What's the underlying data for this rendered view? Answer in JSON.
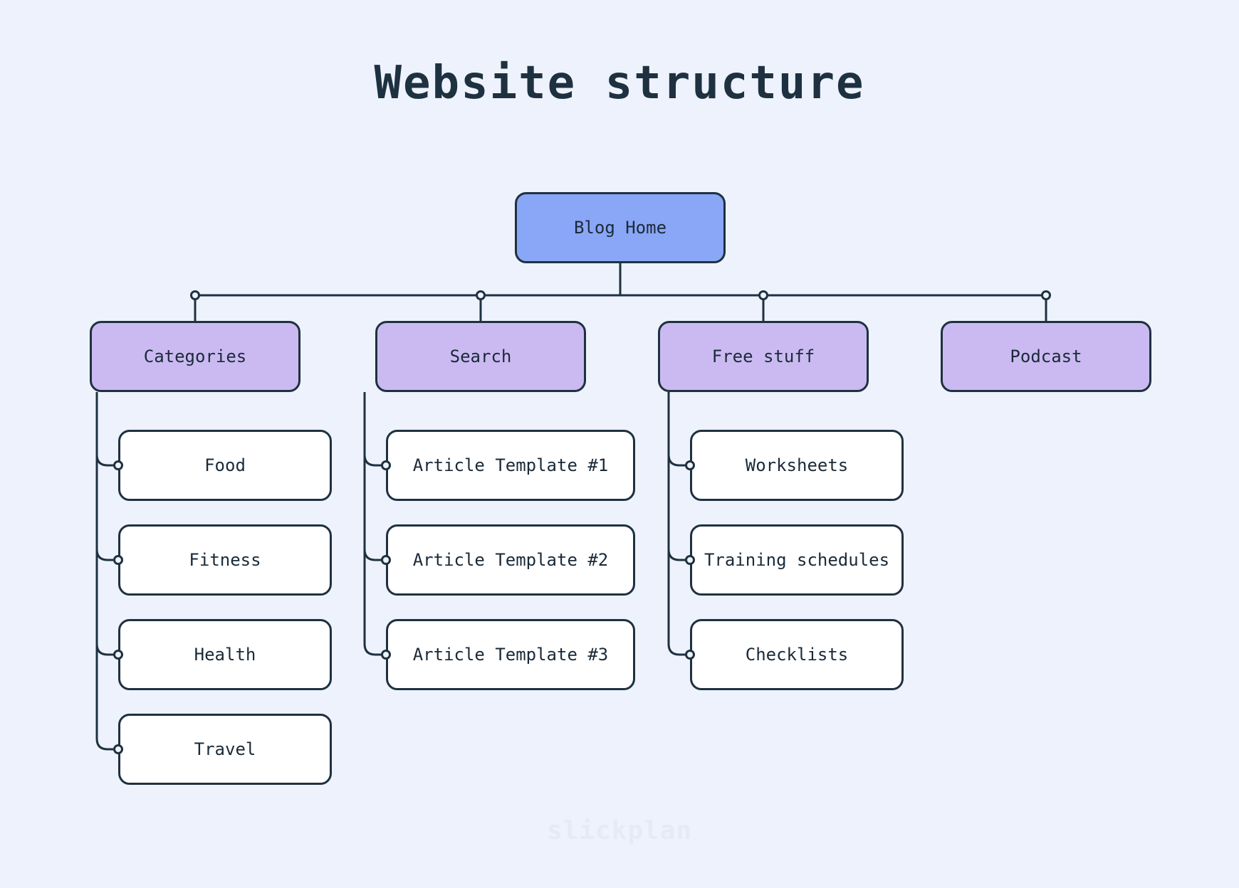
{
  "title": "Website structure",
  "watermark": "slickplan",
  "root": {
    "label": "Blog Home"
  },
  "branches": {
    "categories": {
      "label": "Categories",
      "children": [
        {
          "label": "Food"
        },
        {
          "label": "Fitness"
        },
        {
          "label": "Health"
        },
        {
          "label": "Travel"
        }
      ]
    },
    "search": {
      "label": "Search",
      "children": [
        {
          "label": "Article Template #1"
        },
        {
          "label": "Article Template #2"
        },
        {
          "label": "Article Template #3"
        }
      ]
    },
    "free_stuff": {
      "label": "Free stuff",
      "children": [
        {
          "label": "Worksheets"
        },
        {
          "label": "Training schedules"
        },
        {
          "label": "Checklists"
        }
      ]
    },
    "podcast": {
      "label": "Podcast",
      "children": []
    }
  },
  "colors": {
    "bg": "#eef2fc",
    "stroke": "#1e3140",
    "root_fill": "#8aa6f6",
    "branch_fill": "#cbbaf2",
    "leaf_fill": "#ffffff"
  }
}
